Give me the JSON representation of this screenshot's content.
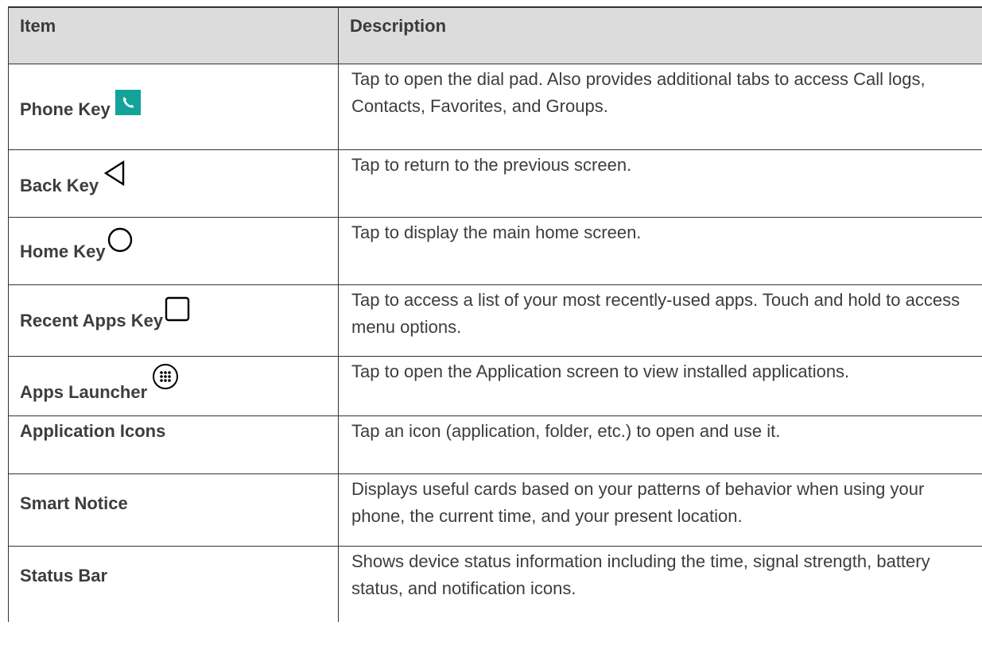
{
  "table": {
    "headers": {
      "item": "Item",
      "description": "Description"
    },
    "rows": [
      {
        "item": "Phone Key",
        "icon": "phone-icon",
        "description": "Tap to open the dial pad. Also provides additional tabs to access Call logs, Contacts, Favorites, and Groups."
      },
      {
        "item": "Back Key",
        "icon": "back-triangle-icon",
        "description": "Tap to return to the previous screen."
      },
      {
        "item": "Home Key",
        "icon": "home-circle-icon",
        "description": "Tap to display the main home screen."
      },
      {
        "item": "Recent Apps Key",
        "icon": "recent-apps-square-icon",
        "description": "Tap to access a list of your most recently-used apps. Touch and hold to access menu options."
      },
      {
        "item": "Apps Launcher",
        "icon": "apps-launcher-icon",
        "description": "Tap to open the Application screen to view installed applications."
      },
      {
        "item": "Application Icons",
        "icon": "",
        "description": "Tap an icon (application, folder, etc.) to open and use it."
      },
      {
        "item": "Smart Notice",
        "icon": "",
        "description": "Displays useful cards based on your patterns of behavior when using your phone, the current time, and your present location."
      },
      {
        "item": "Status Bar",
        "icon": "",
        "description": "Shows device status information including the time, signal strength, battery status, and notification icons."
      }
    ]
  },
  "colors": {
    "header_bg": "#dcdcdc",
    "phone_icon_bg": "#13a39a",
    "text": "#3d3d3d"
  }
}
